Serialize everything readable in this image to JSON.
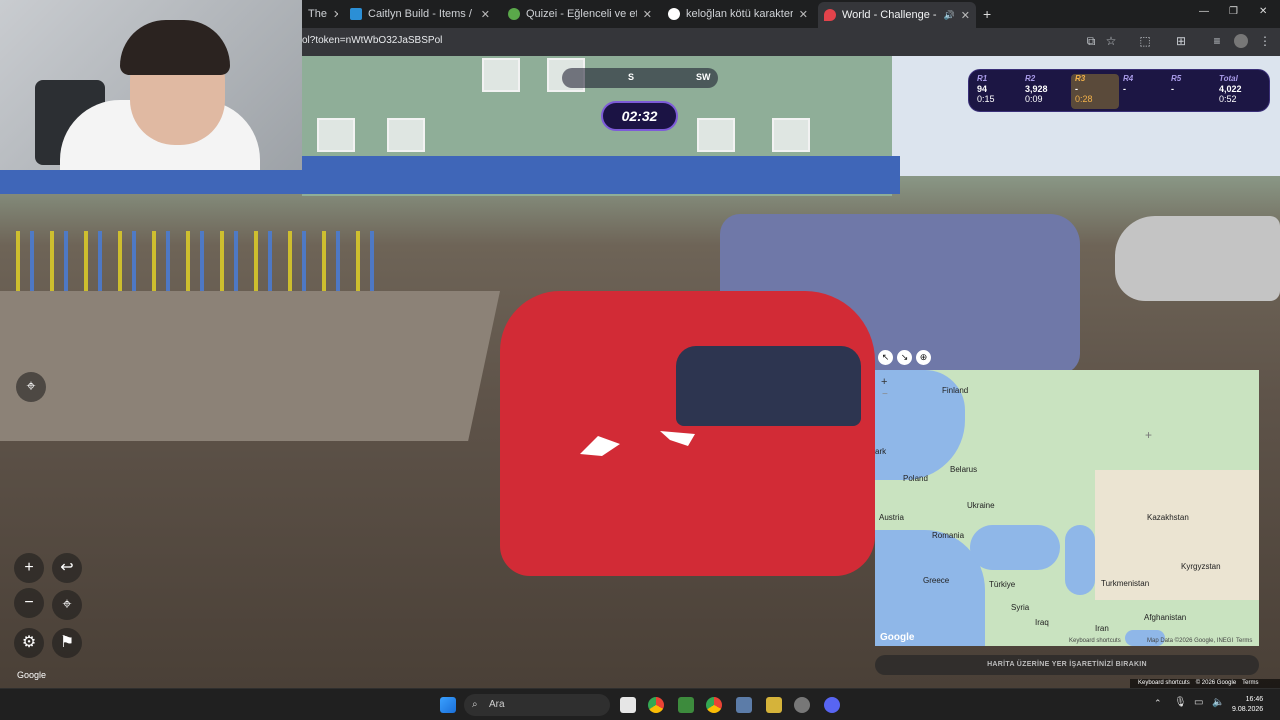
{
  "browser": {
    "tabs": [
      {
        "title": "The",
        "close": "✕"
      },
      {
        "title": "Caitlyn Build - Items / Runes / B",
        "close": "✕"
      },
      {
        "title": "Quizei - Eğlenceli ve etkileşimli",
        "close": "✕"
      },
      {
        "title": "keloğlan kötü karakter - Googl",
        "close": "✕"
      },
      {
        "title": "World - Challenge - GeoGu",
        "close": "✕"
      }
    ],
    "new_tab": "+",
    "url": "ol?token=nWtWbO32JaSBSPol",
    "window_controls": {
      "minimize": "—",
      "maximize": "❐",
      "close": "✕"
    }
  },
  "game": {
    "compass": {
      "left": "S",
      "right": "SW"
    },
    "timer": "02:32",
    "rounds": [
      {
        "label": "R1",
        "points": "94",
        "time": "0:15"
      },
      {
        "label": "R2",
        "points": "3,928",
        "time": "0:09"
      },
      {
        "label": "R3",
        "points": "-",
        "time": "0:28"
      },
      {
        "label": "R4",
        "points": "-",
        "time": ""
      },
      {
        "label": "R5",
        "points": "-",
        "time": ""
      }
    ],
    "total": {
      "label": "Total",
      "points": "4,022",
      "time": "0:52"
    },
    "guess_button": "HARİTA ÜZERİNE YER İŞARETİNİZİ BIRAKIN",
    "google_watermark": "Google",
    "sv_footer": {
      "shortcuts": "Keyboard shortcuts",
      "copyright": "© 2026 Google",
      "terms": "Terms"
    }
  },
  "map": {
    "labels": [
      "Finland",
      "Belarus",
      "Poland",
      "Ukraine",
      "Austria",
      "Romania",
      "Greece",
      "Türkiye",
      "Syria",
      "Iraq",
      "Iran",
      "Kazakhstan",
      "Kyrgyzstan",
      "Turkmenistan",
      "Afghanistan",
      "ark"
    ],
    "footer": {
      "logo": "Google",
      "shortcuts": "Keyboard shortcuts",
      "data": "Map Data ©2026 Google, INEGI",
      "terms": "Terms"
    },
    "zoom_in": "+",
    "zoom_out": "−"
  },
  "taskbar": {
    "search": "Ara",
    "time": "16:46",
    "date": "9.08.2026"
  }
}
